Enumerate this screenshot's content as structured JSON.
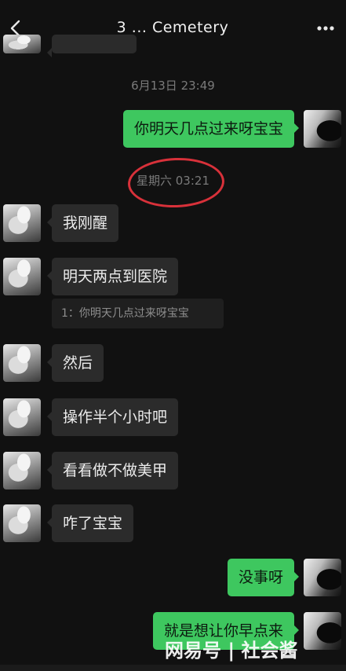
{
  "header": {
    "title": "3  ... Cemetery"
  },
  "timestamps": [
    "6月13日 23:49",
    "星期六 03:21"
  ],
  "messages": [
    {
      "side": "out",
      "text": "你明天几点过来呀宝宝"
    },
    {
      "side": "in",
      "text": "我刚醒"
    },
    {
      "side": "in",
      "text": "明天两点到医院"
    },
    {
      "side": "in",
      "text": "然后"
    },
    {
      "side": "in",
      "text": "操作半个小时吧"
    },
    {
      "side": "in",
      "text": "看看做不做美甲"
    },
    {
      "side": "in",
      "text": "咋了宝宝"
    },
    {
      "side": "out",
      "text": "没事呀"
    },
    {
      "side": "out",
      "text": "就是想让你早点来"
    }
  ],
  "quote": {
    "text": "1：你明天几点过来呀宝宝"
  },
  "watermark": {
    "text": "网易号 | 社会酱"
  },
  "colors": {
    "outgoing_bubble": "#3ec75f",
    "incoming_bubble": "#2b2b2b",
    "highlight_circle": "#d8313a"
  }
}
